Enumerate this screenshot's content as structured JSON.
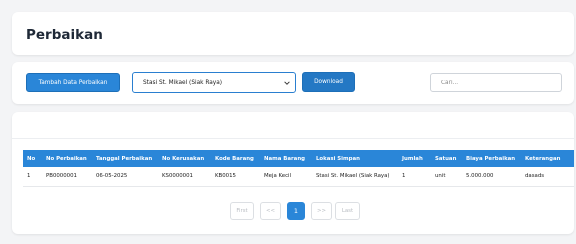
{
  "page": {
    "title": "Perbaikan"
  },
  "toolbar": {
    "add_button_label": "Tambah Data Perbaikan",
    "station_select_value": "Stasi St. Mikael (Siak Raya)",
    "download_label": "Download",
    "search_placeholder": "Cari..."
  },
  "table": {
    "headers": [
      "No",
      "No Perbaikan",
      "Tanggal Perbaikan",
      "No Kerusakan",
      "Kode Barang",
      "Nama Barang",
      "Lokasi Simpan",
      "Jumlah",
      "Satuan",
      "Biaya Perbaikan",
      "Keterangan"
    ],
    "rows": [
      [
        "1",
        "PB0000001",
        "06-05-2025",
        "KS0000001",
        "KB0015",
        "Meja Kecil",
        "Stasi St. Mikael (Siak Raya)",
        "1",
        "unit",
        "5.000.000",
        "dasads"
      ]
    ]
  },
  "pagination": {
    "first": "First",
    "prev": "<<",
    "current": "1",
    "next": ">>",
    "last": "Last"
  },
  "colors": {
    "primary": "#2a86d8",
    "background": "#f3f4f6"
  }
}
